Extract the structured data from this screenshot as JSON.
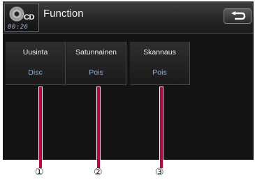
{
  "header": {
    "source_label": "CD",
    "time": "00:26",
    "title": "Function",
    "back_icon": "return-arrow-icon"
  },
  "functions": [
    {
      "label": "Uusinta",
      "value": "Disc"
    },
    {
      "label": "Satunnainen",
      "value": "Pois"
    },
    {
      "label": "Skannaus",
      "value": "Pois"
    }
  ],
  "callouts": [
    "①",
    "②",
    "③"
  ],
  "colors": {
    "callout_line": "#c8003c",
    "value_text": "#8fb0d8",
    "background": "#141414"
  }
}
